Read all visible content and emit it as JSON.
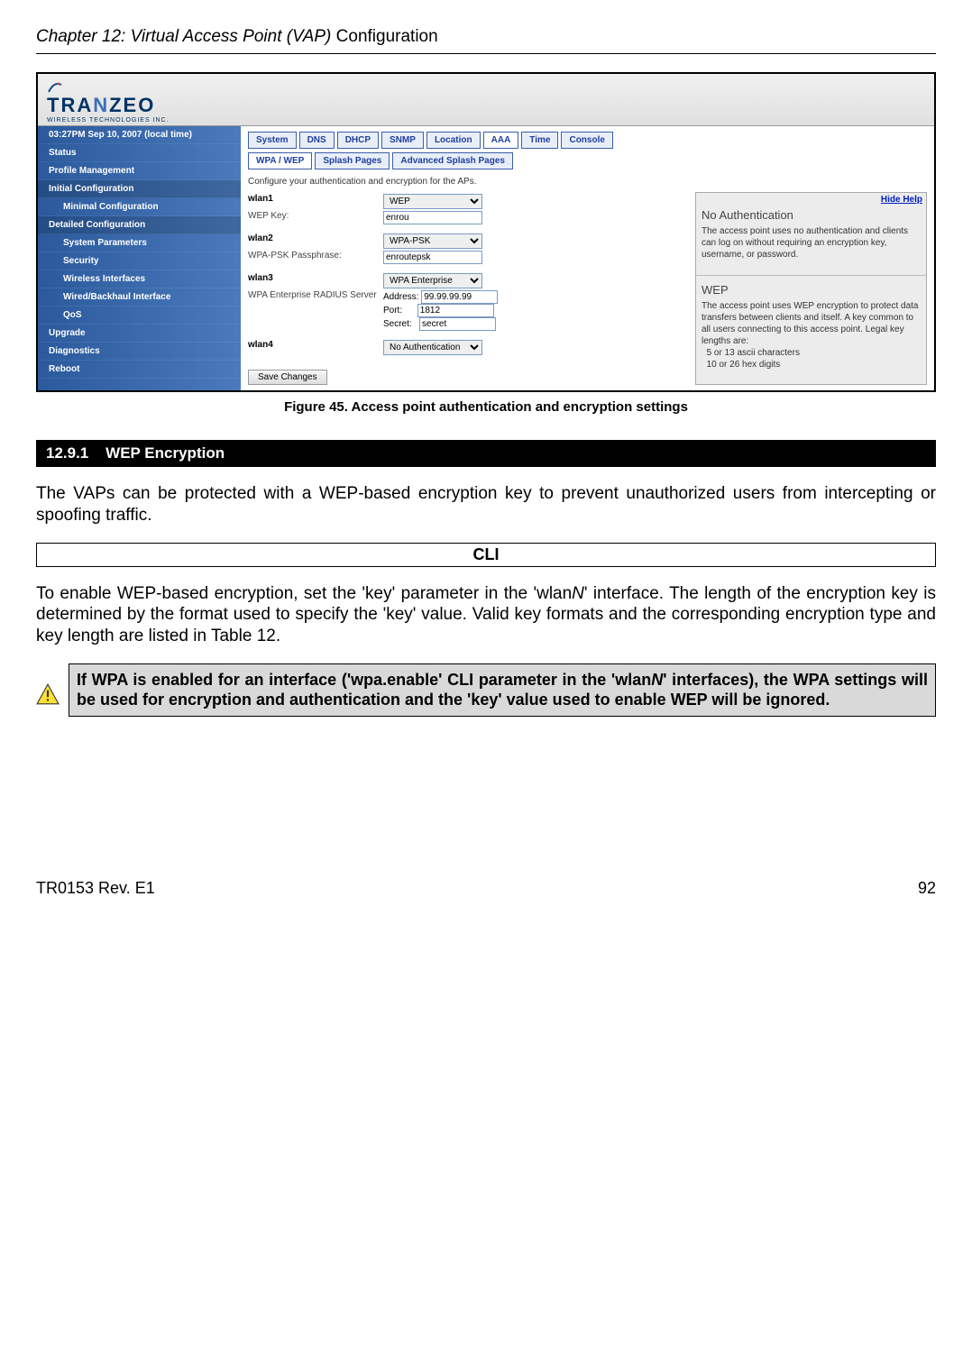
{
  "chapter": {
    "prefix": "Chapter 12: Virtual Access Point (VAP) ",
    "suffix": "Configuration"
  },
  "logo": {
    "part1": "TRA",
    "part2": "N",
    "part3": "ZEO",
    "sub": "WIRELESS  TECHNOLOGIES INC."
  },
  "sidebar": {
    "items": [
      "03:27PM Sep 10, 2007 (local time)",
      "Status",
      "Profile Management",
      "Initial Configuration",
      "Minimal Configuration",
      "Detailed Configuration",
      "System Parameters",
      "Security",
      "Wireless Interfaces",
      "Wired/Backhaul Interface",
      "QoS",
      "Upgrade",
      "Diagnostics",
      "Reboot"
    ]
  },
  "tabs": {
    "row1": [
      "System",
      "DNS",
      "DHCP",
      "SNMP",
      "Location",
      "AAA",
      "Time",
      "Console"
    ],
    "row2": [
      "WPA / WEP",
      "Splash Pages",
      "Advanced Splash Pages"
    ]
  },
  "content": {
    "desc": "Configure your authentication and encryption for the APs.",
    "wlan1": {
      "label": "wlan1",
      "auth": "WEP",
      "key_label": "WEP Key:",
      "key_val": "enrou"
    },
    "wlan2": {
      "label": "wlan2",
      "auth": "WPA-PSK",
      "pass_label": "WPA-PSK Passphrase:",
      "pass_val": "enroutepsk"
    },
    "wlan3": {
      "label": "wlan3",
      "auth": "WPA Enterprise",
      "radius_label": "WPA Enterprise RADIUS Server",
      "addr_l": "Address:",
      "addr_v": "99.99.99.99",
      "port_l": "Port:",
      "port_v": "1812",
      "secret_l": "Secret:",
      "secret_v": "secret"
    },
    "wlan4": {
      "label": "wlan4",
      "auth": "No Authentication"
    },
    "save": "Save Changes"
  },
  "help": {
    "hide": "Hide Help",
    "t1": "No Authentication",
    "b1": "The access point uses no authentication and clients can log on without requiring an encryption key, username, or password.",
    "t2": "WEP",
    "b2": "The access point uses WEP encryption to protect data transfers between clients and itself. A key common to all users connecting to this access point. Legal key lengths are:",
    "b2a": "5 or 13 ascii characters",
    "b2b": "10 or 26 hex digits"
  },
  "caption": "Figure 45. Access point authentication and encryption settings",
  "section": {
    "num": "12.9.1",
    "title": "WEP Encryption"
  },
  "para1": "The VAPs can be protected with a WEP-based encryption key to prevent unauthorized users from intercepting or spoofing traffic.",
  "cli": "CLI",
  "para2a": "To enable WEP-based encryption, set the 'key' parameter in the 'wlan",
  "para2b": "' interface. The length of the encryption key is determined by the format used to specify the 'key' value. Valid key formats and the corresponding encryption type and key length are listed in Table 12.",
  "warn_a": "If WPA is enabled for an interface ('wpa.enable' CLI parameter in the 'wlan",
  "warn_b": "' interfaces), the WPA settings will be used for encryption and authentication and the 'key' value used to enable WEP will be ignored.",
  "N": "N",
  "footer": {
    "left": "TR0153 Rev. E1",
    "right": "92"
  }
}
